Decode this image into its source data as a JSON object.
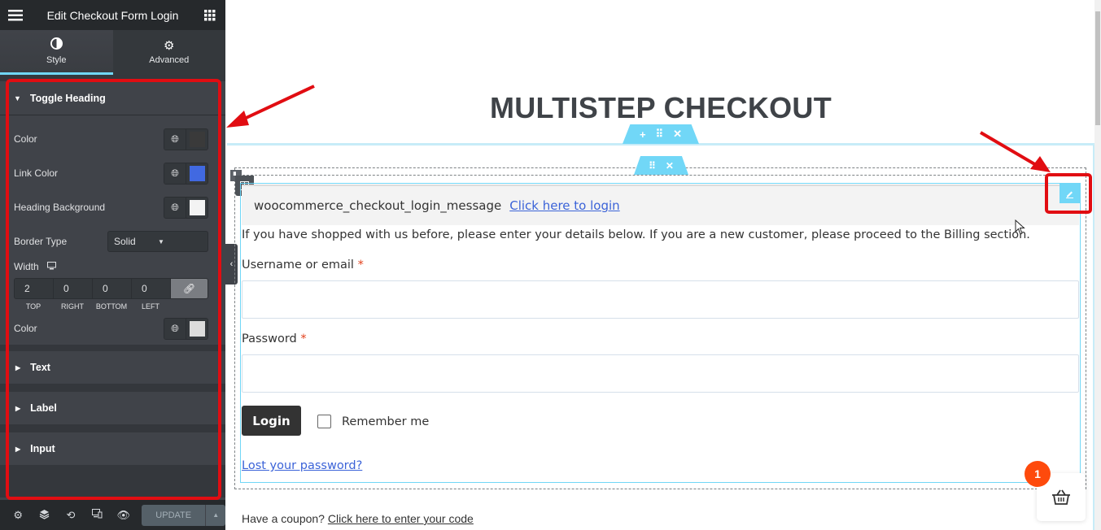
{
  "sidebar": {
    "title": "Edit Checkout Form Login",
    "tabs": [
      {
        "label": "Style",
        "icon": "contrast-icon",
        "active": true
      },
      {
        "label": "Advanced",
        "icon": "gear-icon",
        "active": false
      }
    ],
    "toggle_heading": {
      "title": "Toggle Heading",
      "color_label": "Color",
      "color_value": "#3a3a3a",
      "link_color_label": "Link Color",
      "link_color_value": "#4169e1",
      "background_label": "Heading Background",
      "background_value": "#f3f3f3",
      "border_type_label": "Border Type",
      "border_type_value": "Solid",
      "width_label": "Width",
      "width": {
        "top": "2",
        "right": "0",
        "bottom": "0",
        "left": "0"
      },
      "width_labels": {
        "top": "TOP",
        "right": "RIGHT",
        "bottom": "BOTTOM",
        "left": "LEFT"
      },
      "border_color_label": "Color",
      "border_color_value": "#dcdcdc"
    },
    "collapsed_sections": [
      "Text",
      "Label",
      "Input"
    ],
    "footer": {
      "update_label": "UPDATE"
    }
  },
  "canvas": {
    "page_title": "MULTISTEP CHECKOUT",
    "toggle_message": "woocommerce_checkout_login_message",
    "toggle_link": "Click here to login",
    "intro_text": "If you have shopped with us before, please enter your details below. If you are a new customer, please proceed to the Billing section.",
    "username_label": "Username or email",
    "password_label": "Password",
    "required_mark": "*",
    "username_value": "",
    "password_value": "",
    "login_button": "Login",
    "remember_label": "Remember me",
    "remember_checked": false,
    "lost_password": "Lost your password?",
    "coupon_text": "Have a coupon?",
    "coupon_link": "Click here to enter your code",
    "cart_count": "1"
  },
  "colors": {
    "accent": "#71d7f7",
    "annotation_red": "#e10d12",
    "cart_badge": "#fe4a0c",
    "link": "#3b63d8"
  }
}
